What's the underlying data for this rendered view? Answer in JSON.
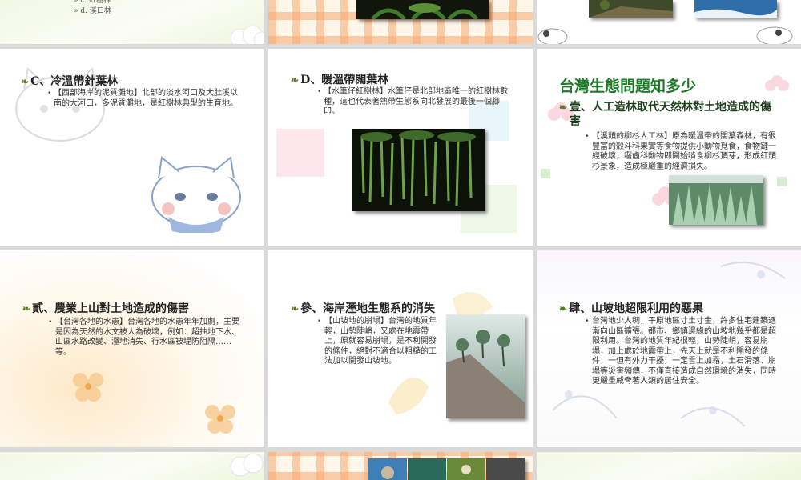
{
  "slides": {
    "top_left": {
      "items": [
        "» c. 紅樹林",
        "» d. 溪口林"
      ]
    },
    "s1": {
      "mark": "❧",
      "title": "C、冷溫帶針葉林",
      "bullet": "•",
      "text": "【西部海岸的泥質灘地】北部的淡水河口及大肚溪以南的大河口，多泥質灘地，是紅樹林典型的生育地。"
    },
    "s2": {
      "mark": "❧",
      "title": "D、暖溫帶闊葉林",
      "bullet": "•",
      "text": "【水筆仔紅樹林】水筆仔是北部地區唯一的紅樹林數種，這也代表著熱帶生態系向北發展的最後一個腳印。"
    },
    "s3": {
      "main_title": "台灣生態問題知多少",
      "mark": "❧",
      "subtitle": "壹、人工造林取代天然林對土地造成的傷害",
      "bullet": "•",
      "text": "【溪頭的柳杉人工林】原為暖溫帶的闊葉森林，有很豐富的殼斗科果實等食物提供小動物覓食，食物鏈一經破壞，囓齒科動物即開始啃食柳杉頂芽，形成紅頭杉景象，造成極嚴重的經濟損失。"
    },
    "s4": {
      "mark": "❧",
      "title": "貳、農業上山對土地造成的傷害",
      "bullet": "•",
      "text": "【台灣各地的水患】台灣各地的水患年年加劇，主要是因為天然的水文被人為破壞，例如：超抽地下水、山區水路改變、溼地消失、行水區被堤防阻隔……等。"
    },
    "s5": {
      "mark": "❧",
      "title": "參、海岸溼地生態系的消失",
      "bullet": "•",
      "text": "【山坡地的崩塌】台灣的地質年輕，山勢陡峭，又處在地震帶上，原就容易崩塌，是不利開發的條件，絕對不適合以粗糙的工法加以開發山坡地。"
    },
    "s6": {
      "mark": "❧",
      "title": "肆、山坡地超限利用的惡果",
      "bullet": "•",
      "text": "台灣地少人稠，平原地區寸土寸金，許多住宅建築逐漸向山區擴張。都市、鄉鎮邊緣的山坡地幾乎都是超限利用。台灣的地質年紀很輕，山勢陡峭，容易崩塌，加上處於地震帶上，先天上就是不利開發的條件，一但有外力干擾，一定雪上加霜，土石滑落、崩塌等災害頻傳，不僅直接造成自然環境的消失，同時更嚴重威脅著人類的居住安全。"
    }
  },
  "colors": {
    "title_green": "#1f7a2a",
    "subtitle_dark": "#1d3f1d",
    "plaid_orange": "#f6a870"
  },
  "icons": [
    "fleuron-bullet-icon",
    "cat-face-icon",
    "flower-icon",
    "sheep-icon",
    "leaf-icon"
  ]
}
